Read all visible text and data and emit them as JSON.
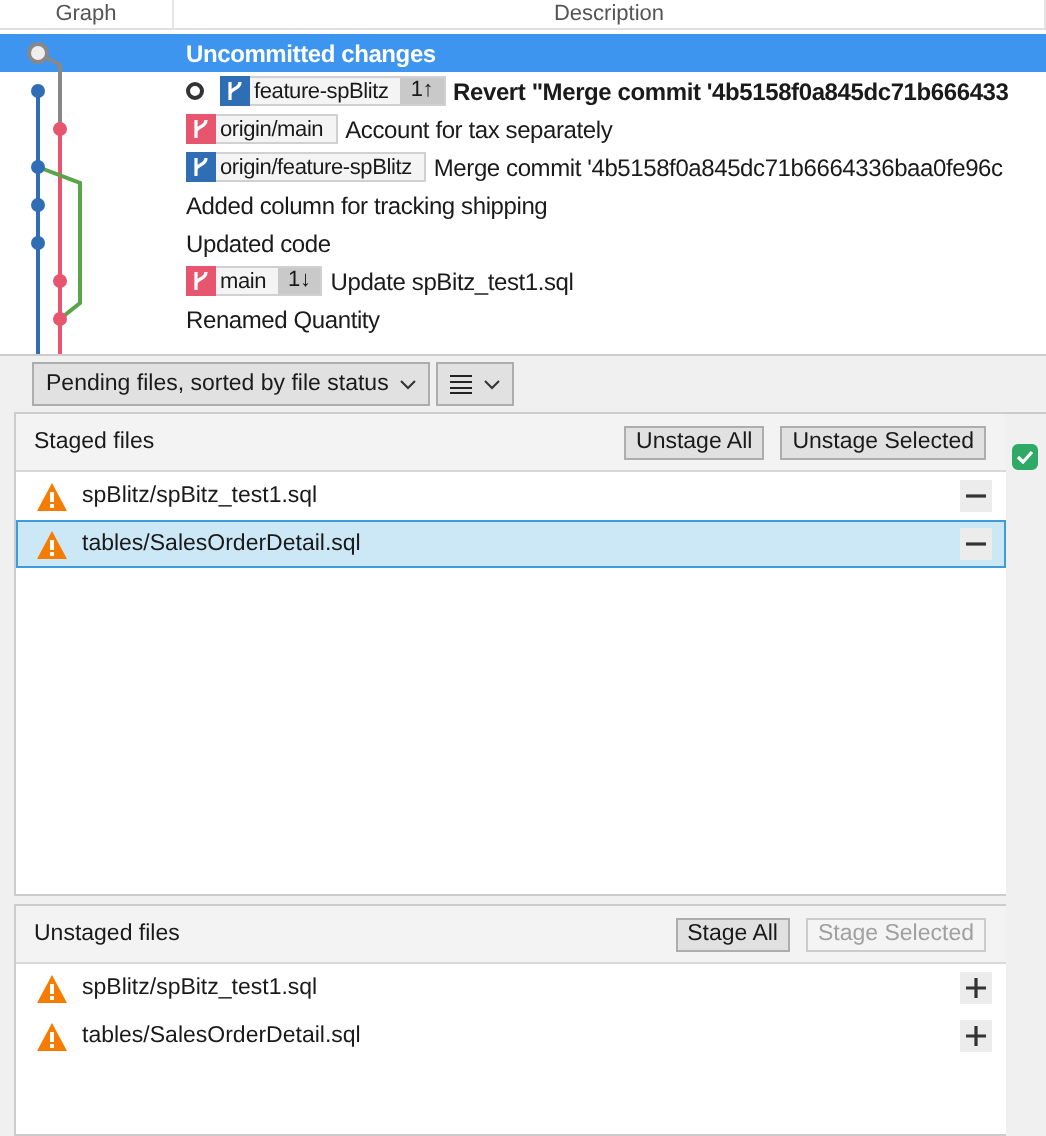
{
  "columns": [
    "Graph",
    "Description"
  ],
  "commits": [
    {
      "kind": "uncommitted",
      "message": "Uncommitted changes",
      "selected": true
    },
    {
      "kind": "commit",
      "message": "Revert \"Merge commit '4b5158f0a845dc71b666433",
      "selected": false,
      "head": true,
      "refs": [
        {
          "name": "feature-spBlitz",
          "count": "1↑",
          "color": "#2f6db5"
        }
      ]
    },
    {
      "kind": "commit",
      "message": "Account for tax separately",
      "selected": false,
      "head": false,
      "refs": [
        {
          "name": "origin/main",
          "color": "#e8556f"
        }
      ]
    },
    {
      "kind": "commit",
      "message": "Merge commit '4b5158f0a845dc71b6664336baa0fe96c",
      "selected": false,
      "head": false,
      "refs": [
        {
          "name": "origin/feature-spBlitz",
          "color": "#2f6db5"
        }
      ]
    },
    {
      "kind": "commit",
      "message": "Added column for tracking shipping",
      "selected": false,
      "head": false
    },
    {
      "kind": "commit",
      "message": "Updated code",
      "selected": false,
      "head": false
    },
    {
      "kind": "commit",
      "message": "Update spBitz_test1.sql",
      "selected": false,
      "head": false,
      "refs": [
        {
          "name": "main",
          "count": "1↓",
          "color": "#e8556f"
        }
      ]
    },
    {
      "kind": "commit",
      "message": "Renamed Quantity",
      "selected": false,
      "head": false
    }
  ],
  "toolbar": {
    "view": "Pending files, sorted by file status"
  },
  "commit_panel": {
    "checked": true
  },
  "staged": {
    "title": "Staged files",
    "buttons": [
      {
        "label": "Unstage All",
        "disabled": false
      },
      {
        "label": "Unstage Selected",
        "disabled": false
      }
    ],
    "files": [
      {
        "name": "spBlitz/spBitz_test1.sql",
        "selected": false
      },
      {
        "name": "tables/SalesOrderDetail.sql",
        "selected": true
      }
    ]
  },
  "unstaged": {
    "title": "Unstaged files",
    "buttons": [
      {
        "label": "Stage All",
        "disabled": false
      },
      {
        "label": "Stage Selected",
        "disabled": true
      }
    ],
    "files": [
      {
        "name": "spBlitz/spBitz_test1.sql",
        "selected": false
      },
      {
        "name": "tables/SalesOrderDetail.sql",
        "selected": false
      }
    ]
  }
}
